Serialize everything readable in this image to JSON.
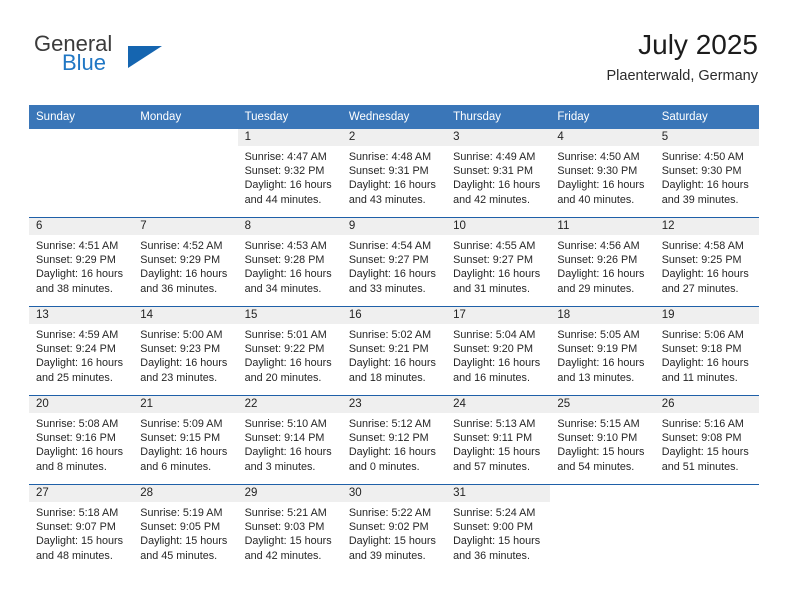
{
  "brand": {
    "name_top": "General",
    "name_bottom": "Blue",
    "accent_color": "#1565b0",
    "blue_text_color": "#2077c4"
  },
  "header": {
    "title": "July 2025",
    "subtitle": "Plaenterwald, Germany"
  },
  "theme": {
    "header_row_bg": "#3a76b8",
    "row_separator": "#1f60a8",
    "daynum_band_bg": "#efefef"
  },
  "weekdays": [
    "Sunday",
    "Monday",
    "Tuesday",
    "Wednesday",
    "Thursday",
    "Friday",
    "Saturday"
  ],
  "weeks": [
    [
      {
        "day": "",
        "lines": []
      },
      {
        "day": "",
        "lines": []
      },
      {
        "day": "1",
        "lines": [
          "Sunrise: 4:47 AM",
          "Sunset: 9:32 PM",
          "Daylight: 16 hours",
          "and 44 minutes."
        ]
      },
      {
        "day": "2",
        "lines": [
          "Sunrise: 4:48 AM",
          "Sunset: 9:31 PM",
          "Daylight: 16 hours",
          "and 43 minutes."
        ]
      },
      {
        "day": "3",
        "lines": [
          "Sunrise: 4:49 AM",
          "Sunset: 9:31 PM",
          "Daylight: 16 hours",
          "and 42 minutes."
        ]
      },
      {
        "day": "4",
        "lines": [
          "Sunrise: 4:50 AM",
          "Sunset: 9:30 PM",
          "Daylight: 16 hours",
          "and 40 minutes."
        ]
      },
      {
        "day": "5",
        "lines": [
          "Sunrise: 4:50 AM",
          "Sunset: 9:30 PM",
          "Daylight: 16 hours",
          "and 39 minutes."
        ]
      }
    ],
    [
      {
        "day": "6",
        "lines": [
          "Sunrise: 4:51 AM",
          "Sunset: 9:29 PM",
          "Daylight: 16 hours",
          "and 38 minutes."
        ]
      },
      {
        "day": "7",
        "lines": [
          "Sunrise: 4:52 AM",
          "Sunset: 9:29 PM",
          "Daylight: 16 hours",
          "and 36 minutes."
        ]
      },
      {
        "day": "8",
        "lines": [
          "Sunrise: 4:53 AM",
          "Sunset: 9:28 PM",
          "Daylight: 16 hours",
          "and 34 minutes."
        ]
      },
      {
        "day": "9",
        "lines": [
          "Sunrise: 4:54 AM",
          "Sunset: 9:27 PM",
          "Daylight: 16 hours",
          "and 33 minutes."
        ]
      },
      {
        "day": "10",
        "lines": [
          "Sunrise: 4:55 AM",
          "Sunset: 9:27 PM",
          "Daylight: 16 hours",
          "and 31 minutes."
        ]
      },
      {
        "day": "11",
        "lines": [
          "Sunrise: 4:56 AM",
          "Sunset: 9:26 PM",
          "Daylight: 16 hours",
          "and 29 minutes."
        ]
      },
      {
        "day": "12",
        "lines": [
          "Sunrise: 4:58 AM",
          "Sunset: 9:25 PM",
          "Daylight: 16 hours",
          "and 27 minutes."
        ]
      }
    ],
    [
      {
        "day": "13",
        "lines": [
          "Sunrise: 4:59 AM",
          "Sunset: 9:24 PM",
          "Daylight: 16 hours",
          "and 25 minutes."
        ]
      },
      {
        "day": "14",
        "lines": [
          "Sunrise: 5:00 AM",
          "Sunset: 9:23 PM",
          "Daylight: 16 hours",
          "and 23 minutes."
        ]
      },
      {
        "day": "15",
        "lines": [
          "Sunrise: 5:01 AM",
          "Sunset: 9:22 PM",
          "Daylight: 16 hours",
          "and 20 minutes."
        ]
      },
      {
        "day": "16",
        "lines": [
          "Sunrise: 5:02 AM",
          "Sunset: 9:21 PM",
          "Daylight: 16 hours",
          "and 18 minutes."
        ]
      },
      {
        "day": "17",
        "lines": [
          "Sunrise: 5:04 AM",
          "Sunset: 9:20 PM",
          "Daylight: 16 hours",
          "and 16 minutes."
        ]
      },
      {
        "day": "18",
        "lines": [
          "Sunrise: 5:05 AM",
          "Sunset: 9:19 PM",
          "Daylight: 16 hours",
          "and 13 minutes."
        ]
      },
      {
        "day": "19",
        "lines": [
          "Sunrise: 5:06 AM",
          "Sunset: 9:18 PM",
          "Daylight: 16 hours",
          "and 11 minutes."
        ]
      }
    ],
    [
      {
        "day": "20",
        "lines": [
          "Sunrise: 5:08 AM",
          "Sunset: 9:16 PM",
          "Daylight: 16 hours",
          "and 8 minutes."
        ]
      },
      {
        "day": "21",
        "lines": [
          "Sunrise: 5:09 AM",
          "Sunset: 9:15 PM",
          "Daylight: 16 hours",
          "and 6 minutes."
        ]
      },
      {
        "day": "22",
        "lines": [
          "Sunrise: 5:10 AM",
          "Sunset: 9:14 PM",
          "Daylight: 16 hours",
          "and 3 minutes."
        ]
      },
      {
        "day": "23",
        "lines": [
          "Sunrise: 5:12 AM",
          "Sunset: 9:12 PM",
          "Daylight: 16 hours",
          "and 0 minutes."
        ]
      },
      {
        "day": "24",
        "lines": [
          "Sunrise: 5:13 AM",
          "Sunset: 9:11 PM",
          "Daylight: 15 hours",
          "and 57 minutes."
        ]
      },
      {
        "day": "25",
        "lines": [
          "Sunrise: 5:15 AM",
          "Sunset: 9:10 PM",
          "Daylight: 15 hours",
          "and 54 minutes."
        ]
      },
      {
        "day": "26",
        "lines": [
          "Sunrise: 5:16 AM",
          "Sunset: 9:08 PM",
          "Daylight: 15 hours",
          "and 51 minutes."
        ]
      }
    ],
    [
      {
        "day": "27",
        "lines": [
          "Sunrise: 5:18 AM",
          "Sunset: 9:07 PM",
          "Daylight: 15 hours",
          "and 48 minutes."
        ]
      },
      {
        "day": "28",
        "lines": [
          "Sunrise: 5:19 AM",
          "Sunset: 9:05 PM",
          "Daylight: 15 hours",
          "and 45 minutes."
        ]
      },
      {
        "day": "29",
        "lines": [
          "Sunrise: 5:21 AM",
          "Sunset: 9:03 PM",
          "Daylight: 15 hours",
          "and 42 minutes."
        ]
      },
      {
        "day": "30",
        "lines": [
          "Sunrise: 5:22 AM",
          "Sunset: 9:02 PM",
          "Daylight: 15 hours",
          "and 39 minutes."
        ]
      },
      {
        "day": "31",
        "lines": [
          "Sunrise: 5:24 AM",
          "Sunset: 9:00 PM",
          "Daylight: 15 hours",
          "and 36 minutes."
        ]
      },
      {
        "day": "",
        "lines": []
      },
      {
        "day": "",
        "lines": []
      }
    ]
  ]
}
